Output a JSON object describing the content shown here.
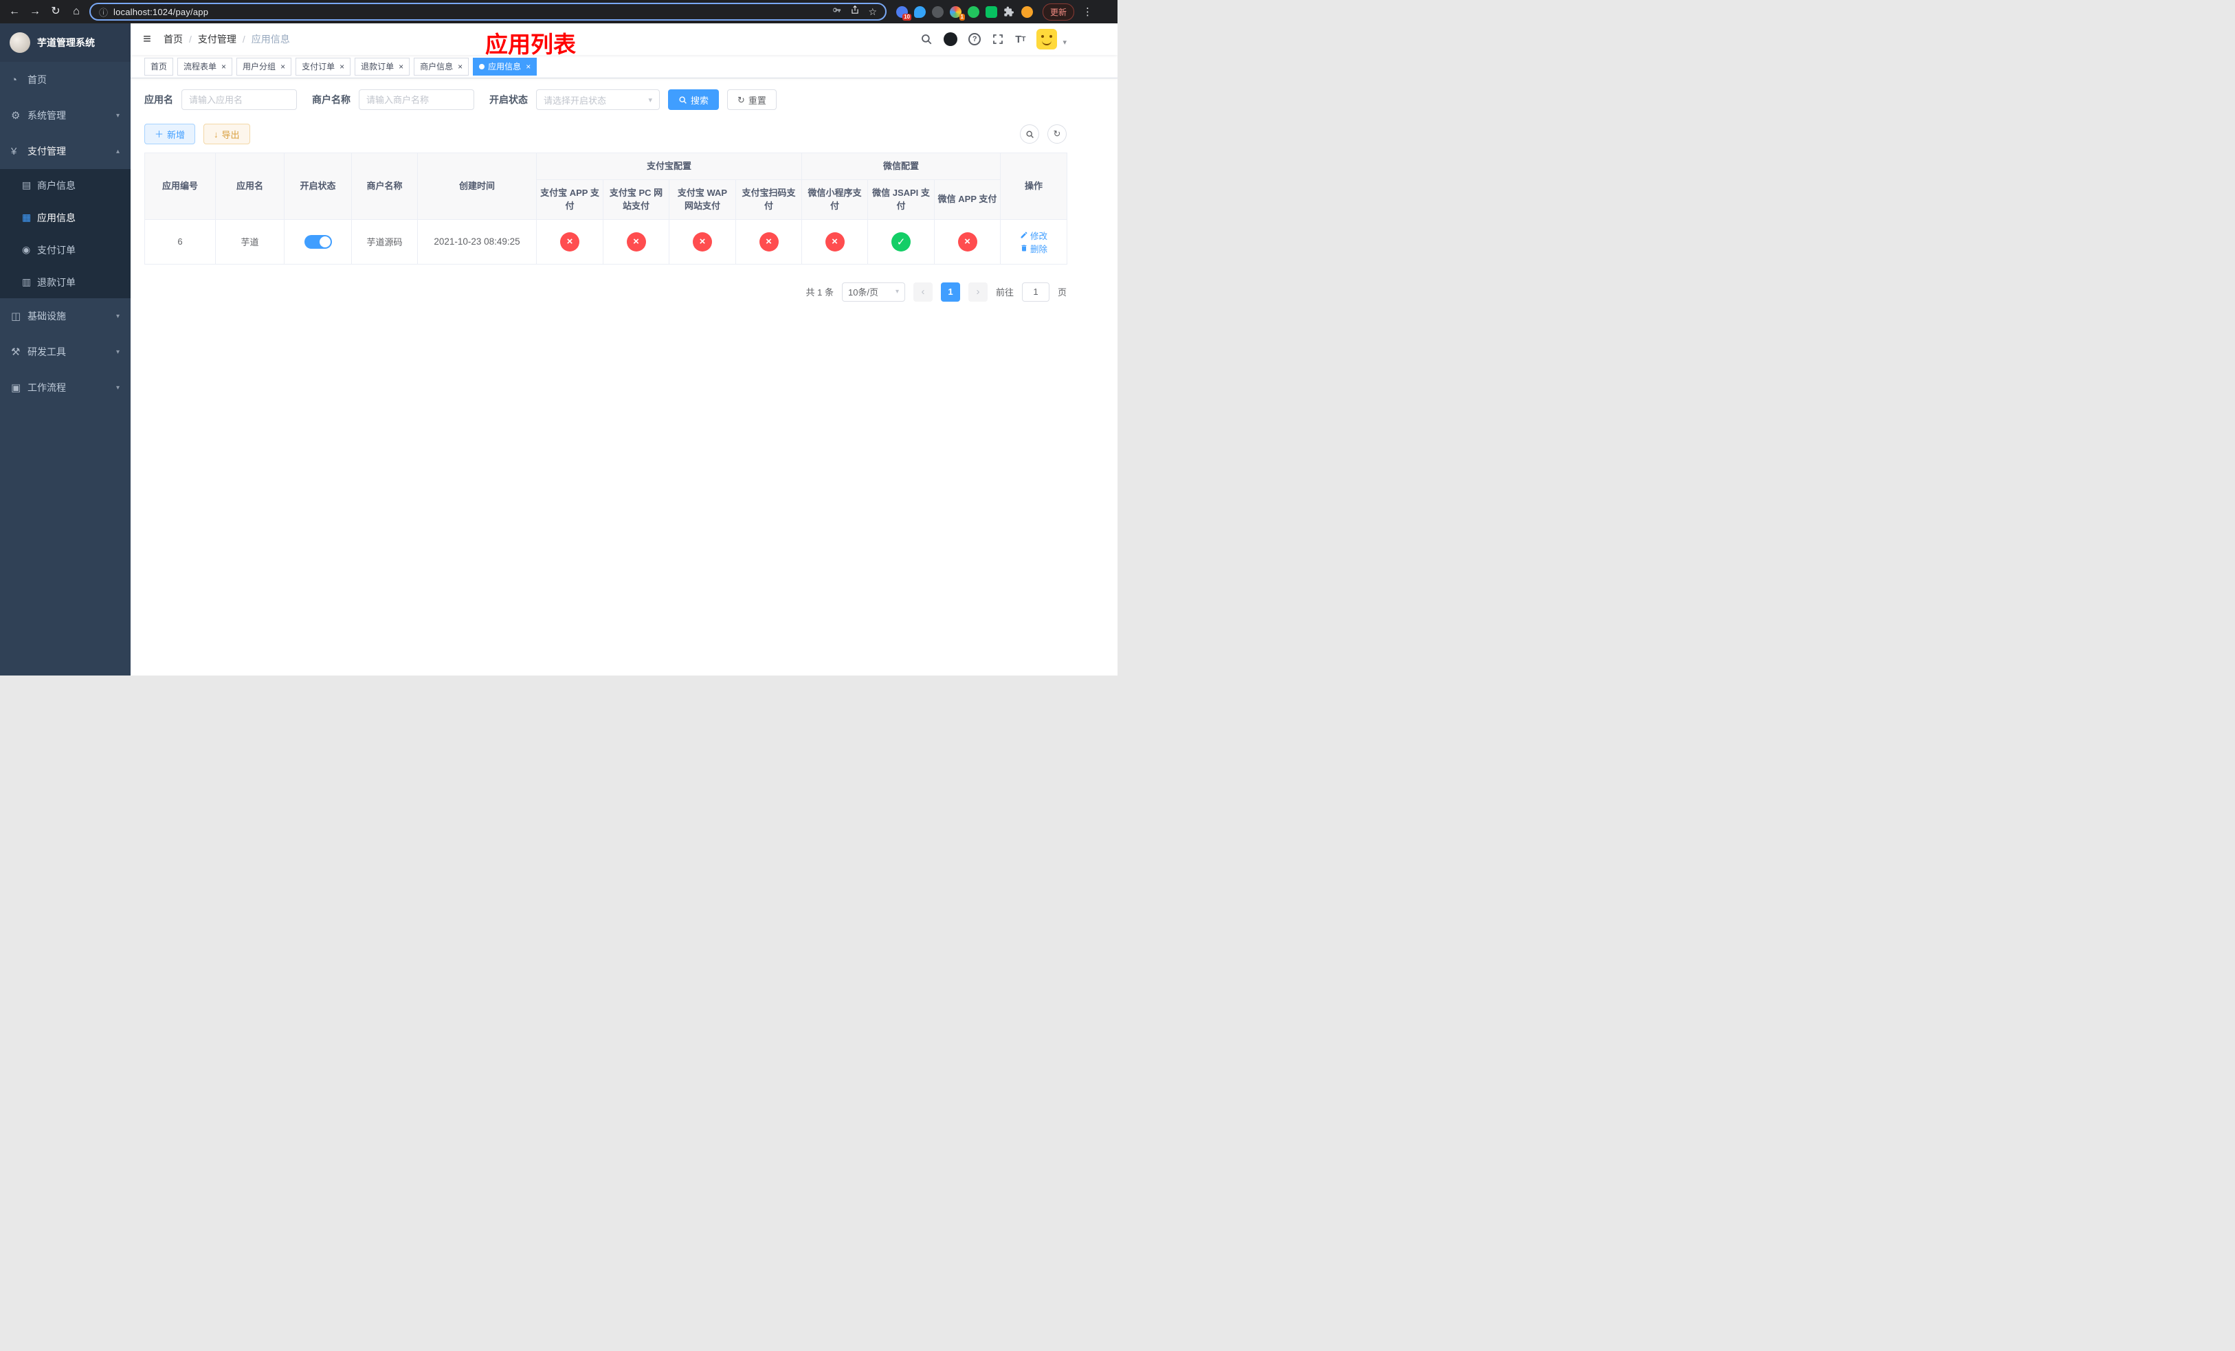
{
  "colors": {
    "accent_blue": "#409eff",
    "success_green": "#13ce66",
    "danger_red": "#ff4d4f",
    "title_red": "#ff0000",
    "sidebar_bg": "#304156",
    "submenu_bg": "#1f2d3d"
  },
  "browser": {
    "url": "localhost:1024/pay/app",
    "update_button": "更新",
    "extension_badge_1": "10",
    "extension_badge_2": "1"
  },
  "sidebar": {
    "logo_title": "芋道管理系统",
    "menu": [
      {
        "name": "home",
        "label": "首页",
        "icon": "dashboard-icon"
      },
      {
        "name": "system",
        "label": "系统管理",
        "icon": "gear-icon",
        "arrow": "down"
      },
      {
        "name": "payment",
        "label": "支付管理",
        "icon": "yen-icon",
        "arrow": "up",
        "active": true,
        "children": [
          {
            "name": "merchant-info",
            "label": "商户信息",
            "icon": "merchant-icon"
          },
          {
            "name": "app-info",
            "label": "应用信息",
            "icon": "app-grid-icon",
            "active": true
          },
          {
            "name": "pay-order",
            "label": "支付订单",
            "icon": "order-icon"
          },
          {
            "name": "refund-order",
            "label": "退款订单",
            "icon": "refund-icon"
          }
        ]
      },
      {
        "name": "infrastructure",
        "label": "基础设施",
        "icon": "infra-icon",
        "arrow": "down"
      },
      {
        "name": "dev-tools",
        "label": "研发工具",
        "icon": "tools-icon",
        "arrow": "down"
      },
      {
        "name": "workflow",
        "label": "工作流程",
        "icon": "workflow-icon",
        "arrow": "down"
      }
    ]
  },
  "navbar": {
    "breadcrumb": [
      "首页",
      "支付管理",
      "应用信息"
    ],
    "page_title": "应用列表"
  },
  "tabs": [
    {
      "name": "home",
      "label": "首页",
      "closable": false
    },
    {
      "name": "process-form",
      "label": "流程表单",
      "closable": true
    },
    {
      "name": "user-group",
      "label": "用户分组",
      "closable": true
    },
    {
      "name": "pay-order",
      "label": "支付订单",
      "closable": true
    },
    {
      "name": "refund-order",
      "label": "退款订单",
      "closable": true
    },
    {
      "name": "merchant-info",
      "label": "商户信息",
      "closable": true
    },
    {
      "name": "app-info",
      "label": "应用信息",
      "closable": true,
      "active": true
    }
  ],
  "filters": {
    "app_name_label": "应用名",
    "app_name_placeholder": "请输入应用名",
    "merchant_label": "商户名称",
    "merchant_placeholder": "请输入商户名称",
    "status_label": "开启状态",
    "status_placeholder": "请选择开启状态",
    "search_button": "搜索",
    "reset_button": "重置"
  },
  "toolbar": {
    "add_button": "新增",
    "export_button": "导出"
  },
  "table": {
    "simple_columns": [
      "应用编号",
      "应用名",
      "开启状态",
      "商户名称",
      "创建时间"
    ],
    "groups": [
      {
        "label": "支付宝配置",
        "columns": [
          "支付宝 APP 支付",
          "支付宝 PC 网站支付",
          "支付宝 WAP 网站支付",
          "支付宝扫码支付"
        ]
      },
      {
        "label": "微信配置",
        "columns": [
          "微信小程序支付",
          "微信 JSAPI 支付",
          "微信 APP 支付"
        ]
      }
    ],
    "action_column": "操作",
    "rows": [
      {
        "id": "6",
        "app_name": "芋道",
        "status_on": true,
        "merchant_name": "芋道源码",
        "create_time": "2021-10-23 08:49:25",
        "configs": [
          "no",
          "no",
          "no",
          "no",
          "no",
          "yes",
          "no"
        ]
      }
    ],
    "row_actions": {
      "edit": "修改",
      "delete": "删除"
    }
  },
  "pagination": {
    "total_text": "共 1 条",
    "page_size": "10条/页",
    "current_page": "1",
    "goto_label": "前往",
    "goto_value": "1",
    "page_unit": "页"
  }
}
